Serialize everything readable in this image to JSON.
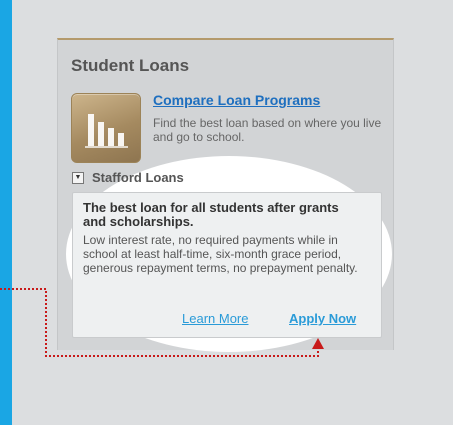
{
  "panel": {
    "title": "Student Loans"
  },
  "promo": {
    "icon": "bar-chart-icon",
    "link_label": "Compare Loan Programs",
    "description": "Find the best loan based on where you live and go to school."
  },
  "section": {
    "toggle_glyph": "▼",
    "title": "Stafford Loans"
  },
  "card": {
    "headline": "The best loan for all students after grants and scholarships.",
    "body": "Low interest rate, no required payments while in school at least half-time, six-month grace period, generous repayment terms, no prepayment penalty.",
    "learn_more_label": "Learn More",
    "apply_label": "Apply Now"
  },
  "colors": {
    "frame": "#1aa6e4",
    "panel_accent": "#b49a6c",
    "link": "#2a9bd8",
    "callout": "#c81a1a"
  }
}
